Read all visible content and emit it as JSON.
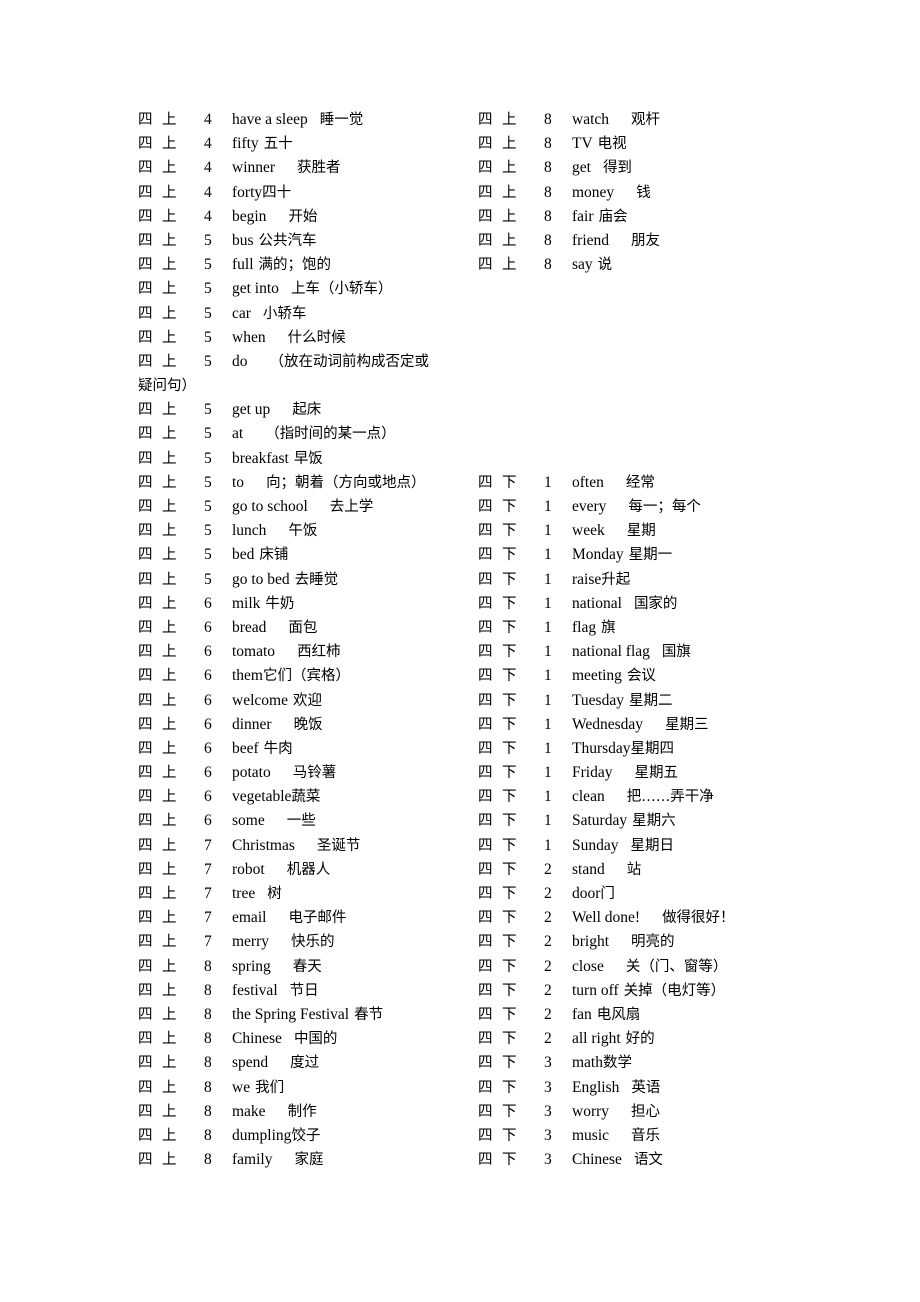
{
  "document": {
    "type": "vocabulary-list",
    "columns": 2,
    "row_format": [
      "grade",
      "term",
      "unit",
      "english",
      "chinese"
    ]
  },
  "left_column": [
    {
      "grade": "四",
      "term": "上",
      "unit": "4",
      "english": "have a sleep",
      "chinese": "睡一觉",
      "gap": 2
    },
    {
      "grade": "四",
      "term": "上",
      "unit": "4",
      "english": "fifty",
      "chinese": "五十",
      "gap": 1
    },
    {
      "grade": "四",
      "term": "上",
      "unit": "4",
      "english": "winner",
      "chinese": "获胜者",
      "gap": 3
    },
    {
      "grade": "四",
      "term": "上",
      "unit": "4",
      "english": "forty",
      "chinese": "四十",
      "gap": 0
    },
    {
      "grade": "四",
      "term": "上",
      "unit": "4",
      "english": "begin",
      "chinese": "开始",
      "gap": 3
    },
    {
      "grade": "四",
      "term": "上",
      "unit": "5",
      "english": "bus",
      "chinese": "公共汽车",
      "gap": 1
    },
    {
      "grade": "四",
      "term": "上",
      "unit": "5",
      "english": "full",
      "chinese": "满的；饱的",
      "gap": 1
    },
    {
      "grade": "四",
      "term": "上",
      "unit": "5",
      "english": "get into",
      "chinese": "上车（小轿车）",
      "gap": 2
    },
    {
      "grade": "四",
      "term": "上",
      "unit": "5",
      "english": "car",
      "chinese": "小轿车",
      "gap": 2
    },
    {
      "grade": "四",
      "term": "上",
      "unit": "5",
      "english": "when",
      "chinese": "什么时候",
      "gap": 3
    },
    {
      "grade": "四",
      "term": "上",
      "unit": "5",
      "english": "do",
      "chinese": "（放在动词前构成否定或",
      "gap": 3,
      "wrap": "疑问句）"
    },
    {
      "grade": "四",
      "term": "上",
      "unit": "5",
      "english": "get up",
      "chinese": "起床",
      "gap": 3
    },
    {
      "grade": "四",
      "term": "上",
      "unit": "5",
      "english": "at",
      "chinese": "（指时间的某一点）",
      "gap": 3
    },
    {
      "grade": "四",
      "term": "上",
      "unit": "5",
      "english": "breakfast",
      "chinese": "早饭",
      "gap": 1
    },
    {
      "grade": "四",
      "term": "上",
      "unit": "5",
      "english": "to",
      "chinese": "向；朝着（方向或地点）",
      "gap": 3
    },
    {
      "grade": "四",
      "term": "上",
      "unit": "5",
      "english": "go to school",
      "chinese": "去上学",
      "gap": 3
    },
    {
      "grade": "四",
      "term": "上",
      "unit": "5",
      "english": "lunch",
      "chinese": "午饭",
      "gap": 3
    },
    {
      "grade": "四",
      "term": "上",
      "unit": "5",
      "english": "bed",
      "chinese": "床铺",
      "gap": 1
    },
    {
      "grade": "四",
      "term": "上",
      "unit": "5",
      "english": "go to bed",
      "chinese": "去睡觉",
      "gap": 1
    },
    {
      "grade": "四",
      "term": "上",
      "unit": "6",
      "english": "milk",
      "chinese": "牛奶",
      "gap": 1
    },
    {
      "grade": "四",
      "term": "上",
      "unit": "6",
      "english": "bread",
      "chinese": "面包",
      "gap": 3
    },
    {
      "grade": "四",
      "term": "上",
      "unit": "6",
      "english": "tomato",
      "chinese": "西红柿",
      "gap": 3
    },
    {
      "grade": "四",
      "term": "上",
      "unit": "6",
      "english": "them",
      "chinese": "它们（宾格）",
      "gap": 0
    },
    {
      "grade": "四",
      "term": "上",
      "unit": "6",
      "english": "welcome",
      "chinese": "欢迎",
      "gap": 1
    },
    {
      "grade": "四",
      "term": "上",
      "unit": "6",
      "english": "dinner",
      "chinese": "晚饭",
      "gap": 3
    },
    {
      "grade": "四",
      "term": "上",
      "unit": "6",
      "english": "beef",
      "chinese": "牛肉",
      "gap": 1
    },
    {
      "grade": "四",
      "term": "上",
      "unit": "6",
      "english": "potato",
      "chinese": "马铃薯",
      "gap": 3
    },
    {
      "grade": "四",
      "term": "上",
      "unit": "6",
      "english": "vegetable",
      "chinese": "蔬菜",
      "gap": 0
    },
    {
      "grade": "四",
      "term": "上",
      "unit": "6",
      "english": "some",
      "chinese": "一些",
      "gap": 3
    },
    {
      "grade": "四",
      "term": "上",
      "unit": "7",
      "english": "Christmas",
      "chinese": "圣诞节",
      "gap": 3
    },
    {
      "grade": "四",
      "term": "上",
      "unit": "7",
      "english": "robot",
      "chinese": "机器人",
      "gap": 3
    },
    {
      "grade": "四",
      "term": "上",
      "unit": "7",
      "english": "tree",
      "chinese": "树",
      "gap": 2
    },
    {
      "grade": "四",
      "term": "上",
      "unit": "7",
      "english": "email",
      "chinese": "电子邮件",
      "gap": 3
    },
    {
      "grade": "四",
      "term": "上",
      "unit": "7",
      "english": "merry",
      "chinese": "快乐的",
      "gap": 3
    },
    {
      "grade": "四",
      "term": "上",
      "unit": "8",
      "english": "spring",
      "chinese": "春天",
      "gap": 3
    },
    {
      "grade": "四",
      "term": "上",
      "unit": "8",
      "english": "festival",
      "chinese": "节日",
      "gap": 2
    },
    {
      "grade": "四",
      "term": "上",
      "unit": "8",
      "english": "the Spring Festival",
      "chinese": "春节",
      "gap": 1
    },
    {
      "grade": "四",
      "term": "上",
      "unit": "8",
      "english": "Chinese",
      "chinese": "中国的",
      "gap": 2
    },
    {
      "grade": "四",
      "term": "上",
      "unit": "8",
      "english": "spend",
      "chinese": "度过",
      "gap": 3
    },
    {
      "grade": "四",
      "term": "上",
      "unit": "8",
      "english": "we",
      "chinese": "我们",
      "gap": 1
    },
    {
      "grade": "四",
      "term": "上",
      "unit": "8",
      "english": "make",
      "chinese": "制作",
      "gap": 3
    },
    {
      "grade": "四",
      "term": "上",
      "unit": "8",
      "english": "dumpling",
      "chinese": "饺子",
      "gap": 0
    },
    {
      "grade": "四",
      "term": "上",
      "unit": "8",
      "english": "family",
      "chinese": "家庭",
      "gap": 3
    }
  ],
  "right_column": [
    {
      "grade": "四",
      "term": "上",
      "unit": "8",
      "english": "watch",
      "chinese": "观杆",
      "gap": 3
    },
    {
      "grade": "四",
      "term": "上",
      "unit": "8",
      "english": "TV",
      "chinese": "电视",
      "gap": 1
    },
    {
      "grade": "四",
      "term": "上",
      "unit": "8",
      "english": "get",
      "chinese": "得到",
      "gap": 2
    },
    {
      "grade": "四",
      "term": "上",
      "unit": "8",
      "english": "money",
      "chinese": "钱",
      "gap": 3
    },
    {
      "grade": "四",
      "term": "上",
      "unit": "8",
      "english": "fair",
      "chinese": "庙会",
      "gap": 1
    },
    {
      "grade": "四",
      "term": "上",
      "unit": "8",
      "english": "friend",
      "chinese": "朋友",
      "gap": 3
    },
    {
      "grade": "四",
      "term": "上",
      "unit": "8",
      "english": "say",
      "chinese": "说",
      "gap": 1
    },
    {
      "spacer": true
    },
    {
      "spacer": true
    },
    {
      "spacer": true
    },
    {
      "spacer": true
    },
    {
      "spacer": true
    },
    {
      "spacer": true
    },
    {
      "spacer": true
    },
    {
      "spacer": true
    },
    {
      "grade": "四",
      "term": "下",
      "unit": "1",
      "english": "often",
      "chinese": "经常",
      "gap": 3
    },
    {
      "grade": "四",
      "term": "下",
      "unit": "1",
      "english": "every",
      "chinese": "每一；每个",
      "gap": 3
    },
    {
      "grade": "四",
      "term": "下",
      "unit": "1",
      "english": "week",
      "chinese": "星期",
      "gap": 3
    },
    {
      "grade": "四",
      "term": "下",
      "unit": "1",
      "english": "Monday",
      "chinese": "星期一",
      "gap": 1
    },
    {
      "grade": "四",
      "term": "下",
      "unit": "1",
      "english": "raise",
      "chinese": "升起",
      "gap": 0
    },
    {
      "grade": "四",
      "term": "下",
      "unit": "1",
      "english": "national",
      "chinese": "国家的",
      "gap": 2
    },
    {
      "grade": "四",
      "term": "下",
      "unit": "1",
      "english": "flag",
      "chinese": "旗",
      "gap": 1
    },
    {
      "grade": "四",
      "term": "下",
      "unit": "1",
      "english": "national flag",
      "chinese": "国旗",
      "gap": 2
    },
    {
      "grade": "四",
      "term": "下",
      "unit": "1",
      "english": "meeting",
      "chinese": "会议",
      "gap": 1
    },
    {
      "grade": "四",
      "term": "下",
      "unit": "1",
      "english": "Tuesday",
      "chinese": "星期二",
      "gap": 1
    },
    {
      "grade": "四",
      "term": "下",
      "unit": "1",
      "english": "Wednesday",
      "chinese": "星期三",
      "gap": 3
    },
    {
      "grade": "四",
      "term": "下",
      "unit": "1",
      "english": "Thursday",
      "chinese": "星期四",
      "gap": 0
    },
    {
      "grade": "四",
      "term": "下",
      "unit": "1",
      "english": "Friday",
      "chinese": "星期五",
      "gap": 3
    },
    {
      "grade": "四",
      "term": "下",
      "unit": "1",
      "english": "clean",
      "chinese": "把……弄干净",
      "gap": 3
    },
    {
      "grade": "四",
      "term": "下",
      "unit": "1",
      "english": "Saturday",
      "chinese": "星期六",
      "gap": 1
    },
    {
      "grade": "四",
      "term": "下",
      "unit": "1",
      "english": "Sunday",
      "chinese": "星期日",
      "gap": 2
    },
    {
      "grade": "四",
      "term": "下",
      "unit": "2",
      "english": "stand",
      "chinese": "站",
      "gap": 3
    },
    {
      "grade": "四",
      "term": "下",
      "unit": "2",
      "english": "door",
      "chinese": "门",
      "gap": 0
    },
    {
      "grade": "四",
      "term": "下",
      "unit": "2",
      "english": "Well done!",
      "chinese": "做得很好！",
      "gap": 3
    },
    {
      "grade": "四",
      "term": "下",
      "unit": "2",
      "english": "bright",
      "chinese": "明亮的",
      "gap": 3
    },
    {
      "grade": "四",
      "term": "下",
      "unit": "2",
      "english": "close",
      "chinese": "关（门、窗等）",
      "gap": 3
    },
    {
      "grade": "四",
      "term": "下",
      "unit": "2",
      "english": "turn off",
      "chinese": "关掉（电灯等）",
      "gap": 1
    },
    {
      "grade": "四",
      "term": "下",
      "unit": "2",
      "english": "fan",
      "chinese": "电风扇",
      "gap": 1
    },
    {
      "grade": "四",
      "term": "下",
      "unit": "2",
      "english": "all right",
      "chinese": "好的",
      "gap": 1
    },
    {
      "grade": "四",
      "term": "下",
      "unit": "3",
      "english": "math",
      "chinese": "数学",
      "gap": 0
    },
    {
      "grade": "四",
      "term": "下",
      "unit": "3",
      "english": "English",
      "chinese": "英语",
      "gap": 2
    },
    {
      "grade": "四",
      "term": "下",
      "unit": "3",
      "english": "worry",
      "chinese": "担心",
      "gap": 3
    },
    {
      "grade": "四",
      "term": "下",
      "unit": "3",
      "english": "music",
      "chinese": "音乐",
      "gap": 3
    },
    {
      "grade": "四",
      "term": "下",
      "unit": "3",
      "english": "Chinese",
      "chinese": "语文",
      "gap": 2
    }
  ]
}
